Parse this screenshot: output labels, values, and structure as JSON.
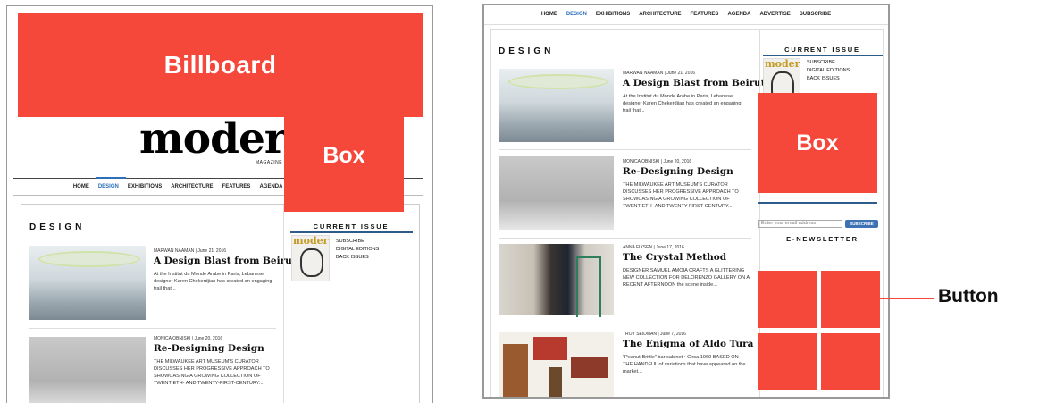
{
  "annotations": {
    "billboard": "Billboard",
    "box": "Box",
    "button": "Button"
  },
  "logo": {
    "text": "modern",
    "sub": "MAGAZINE"
  },
  "nav": [
    "HOME",
    "DESIGN",
    "EXHIBITIONS",
    "ARCHITECTURE",
    "FEATURES",
    "AGENDA",
    "ADVERTISE",
    "SUBSCRIBE"
  ],
  "section_title": "DESIGN",
  "sidebar": {
    "current_issue": "CURRENT ISSUE",
    "cover_logo": "modern",
    "links": [
      "SUBSCRIBE",
      "DIGITAL EDITIONS",
      "BACK ISSUES"
    ],
    "newsletter_title": "E-NEWSLETTER",
    "email_placeholder": "Enter your email address",
    "subscribe_button": "SUBSCRIBE"
  },
  "articles": [
    {
      "meta": "MARWAN NAAMAN | June 21, 2016",
      "title": "A Design Blast from Beirut",
      "excerpt": "At the Institut du Monde Arabe in Paris, Lebanese designer Karen Chekerdjian has created an engaging trail that..."
    },
    {
      "meta": "MONICA OBNISKI | June 20, 2016",
      "title": "Re-Designing Design",
      "excerpt": "THE MILWAUKEE ART MUSEUM'S CURATOR DISCUSSES HER PROGRESSIVE APPROACH TO SHOWCASING A GROWING COLLECTION OF TWENTIETH- AND TWENTY-FIRST-CENTURY..."
    },
    {
      "meta": "ANNA FIXSEN | June 17, 2016",
      "title": "The Crystal Method",
      "excerpt": "DESIGNER SAMUEL AMOIA CRAFTS A GLITTERING NEW COLLECTION FOR DELORENZO GALLERY ON A RECENT AFTERNOON the scene inside..."
    },
    {
      "meta": "TROY SEIDMAN | June 7, 2016",
      "title": "The Enigma of Aldo Tura",
      "excerpt": "\"Peanut-Brittle\" bar cabinet • Circa 1960 BASED ON THE HANDFUL of variations that have appeared on the market..."
    }
  ],
  "colors": {
    "ad_red": "#f5473a",
    "nav_active": "#2d6fb8",
    "rule_blue": "#2d5c8a"
  }
}
